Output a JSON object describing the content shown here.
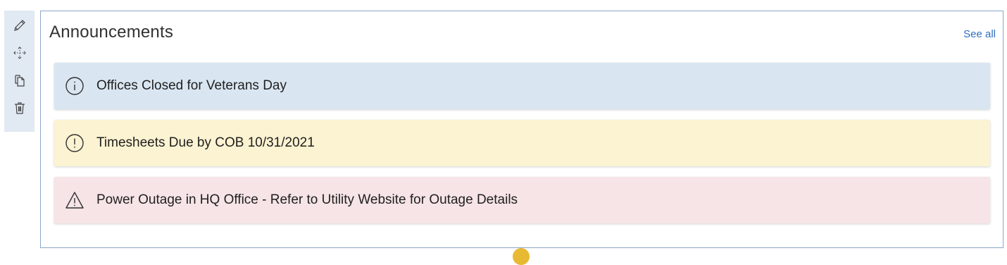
{
  "toolbar": {
    "items": [
      {
        "name": "edit",
        "icon": "pencil-icon"
      },
      {
        "name": "move",
        "icon": "move-icon"
      },
      {
        "name": "duplicate",
        "icon": "copy-icon"
      },
      {
        "name": "delete",
        "icon": "trash-icon"
      }
    ]
  },
  "webpart": {
    "title": "Announcements",
    "see_all": "See all"
  },
  "announcements": [
    {
      "text": "Offices Closed for Veterans Day",
      "icon": "info-icon",
      "color": "#d9e6f2"
    },
    {
      "text": "Timesheets Due by COB 10/31/2021",
      "icon": "exclamation-circle-icon",
      "color": "#fcf3d2"
    },
    {
      "text": "Power Outage in HQ Office - Refer to Utility Website for Outage Details",
      "icon": "warning-triangle-icon",
      "color": "#f6e4e6"
    }
  ],
  "colors": {
    "accent": "#2f6fbd",
    "toolbar_bg": "#e1e9f3",
    "border": "#8aa6c9",
    "handle": "#e8b932"
  }
}
